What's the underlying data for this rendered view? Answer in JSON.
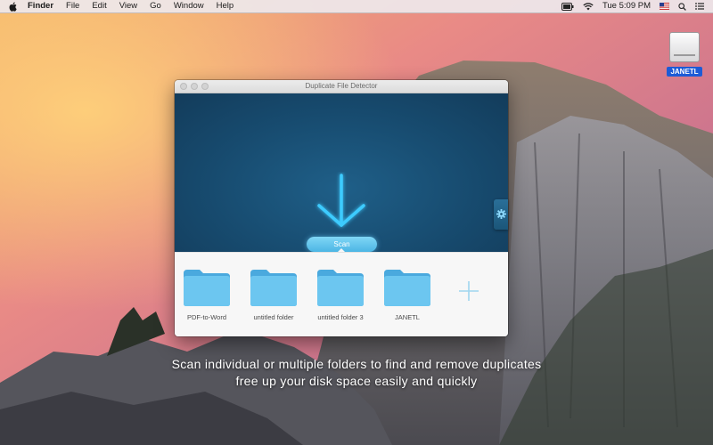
{
  "menubar": {
    "app_name": "Finder",
    "menus": [
      "File",
      "Edit",
      "View",
      "Go",
      "Window",
      "Help"
    ],
    "clock": "Tue 5:09 PM",
    "status_icons": [
      "battery-icon",
      "wifi-icon",
      "flag-icon",
      "search-icon",
      "list-icon"
    ]
  },
  "desktop": {
    "drive_label": "JANETL"
  },
  "window": {
    "title": "Duplicate File Detector",
    "scan_label": "Scan",
    "folders": [
      {
        "label": "PDF-to-Word"
      },
      {
        "label": "untitled folder"
      },
      {
        "label": "untitled folder 3"
      },
      {
        "label": "JANETL"
      }
    ]
  },
  "caption": {
    "line1": "Scan individual or multiple folders to find and remove duplicates",
    "line2": "free up your disk space easily and quickly"
  },
  "colors": {
    "accent": "#5bc8f5",
    "folder": "#5ab7e8",
    "panel": "#174b6f"
  }
}
